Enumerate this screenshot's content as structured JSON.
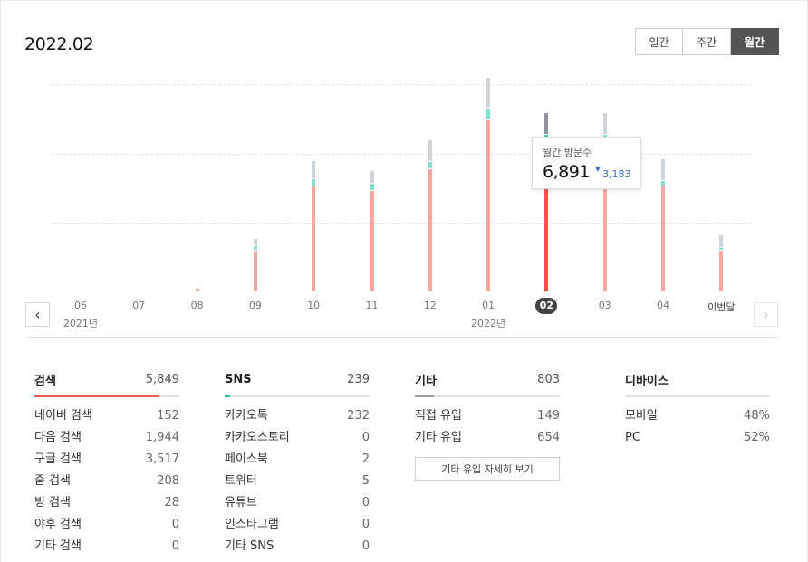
{
  "period_title": "2022.02",
  "period_tabs": [
    {
      "label": "일간",
      "active": false
    },
    {
      "label": "주간",
      "active": false
    },
    {
      "label": "월간",
      "active": true
    }
  ],
  "chart_data": {
    "type": "bar",
    "stacked": true,
    "categories": [
      "06",
      "07",
      "08",
      "09",
      "10",
      "11",
      "12",
      "01",
      "02",
      "03",
      "04",
      "이번달"
    ],
    "year_labels": [
      {
        "category": "06",
        "label": "2021년"
      },
      {
        "category": "01",
        "label": "2022년"
      }
    ],
    "selected_category": "02",
    "series": [
      {
        "values": [
          0,
          0,
          40,
          620,
          1620,
          1550,
          1880,
          2630,
          2290,
          2280,
          1620,
          620
        ],
        "color": "#f8a99f"
      },
      {
        "values": [
          0,
          0,
          0,
          60,
          90,
          90,
          100,
          170,
          100,
          110,
          70,
          30
        ],
        "color": "#7fe0d2"
      },
      {
        "values": [
          0,
          0,
          0,
          100,
          260,
          180,
          310,
          450,
          320,
          320,
          320,
          180
        ],
        "color": "#cfd4d8"
      }
    ],
    "ylim": [
      0,
      3200
    ],
    "grid": true,
    "legend": false
  },
  "tooltip": {
    "label": "월간 방문수",
    "value": "6,891",
    "diff_arrow": "▼",
    "diff": "3,183"
  },
  "nav": {
    "prev_icon": "‹",
    "next_icon": "›"
  },
  "stats": {
    "search": {
      "title": "검색",
      "total": "5,849",
      "bar_fraction": 0.86,
      "bar_color": "#e8584e",
      "rows": [
        {
          "label": "네이버 검색",
          "value": "152"
        },
        {
          "label": "다음 검색",
          "value": "1,944"
        },
        {
          "label": "구글 검색",
          "value": "3,517"
        },
        {
          "label": "줌 검색",
          "value": "208"
        },
        {
          "label": "빙 검색",
          "value": "28"
        },
        {
          "label": "야후 검색",
          "value": "0"
        },
        {
          "label": "기타 검색",
          "value": "0"
        }
      ]
    },
    "sns": {
      "title": "SNS",
      "total": "239",
      "bar_fraction": 0.04,
      "bar_color": "#2bb9a4",
      "rows": [
        {
          "label": "카카오톡",
          "value": "232"
        },
        {
          "label": "카카오스토리",
          "value": "0"
        },
        {
          "label": "페이스북",
          "value": "2"
        },
        {
          "label": "트위터",
          "value": "5"
        },
        {
          "label": "유튜브",
          "value": "0"
        },
        {
          "label": "인스타그램",
          "value": "0"
        },
        {
          "label": "기타 SNS",
          "value": "0"
        }
      ]
    },
    "etc": {
      "title": "기타",
      "total": "803",
      "bar_fraction": 0.13,
      "bar_color": "#9aa0a6",
      "rows": [
        {
          "label": "직접 유입",
          "value": "149"
        },
        {
          "label": "기타 유입",
          "value": "654"
        }
      ],
      "detail_button": "기타 유입 자세히 보기"
    },
    "device": {
      "title": "디바이스",
      "rows": [
        {
          "label": "모바일",
          "value": "48%"
        },
        {
          "label": "PC",
          "value": "52%"
        }
      ]
    }
  }
}
